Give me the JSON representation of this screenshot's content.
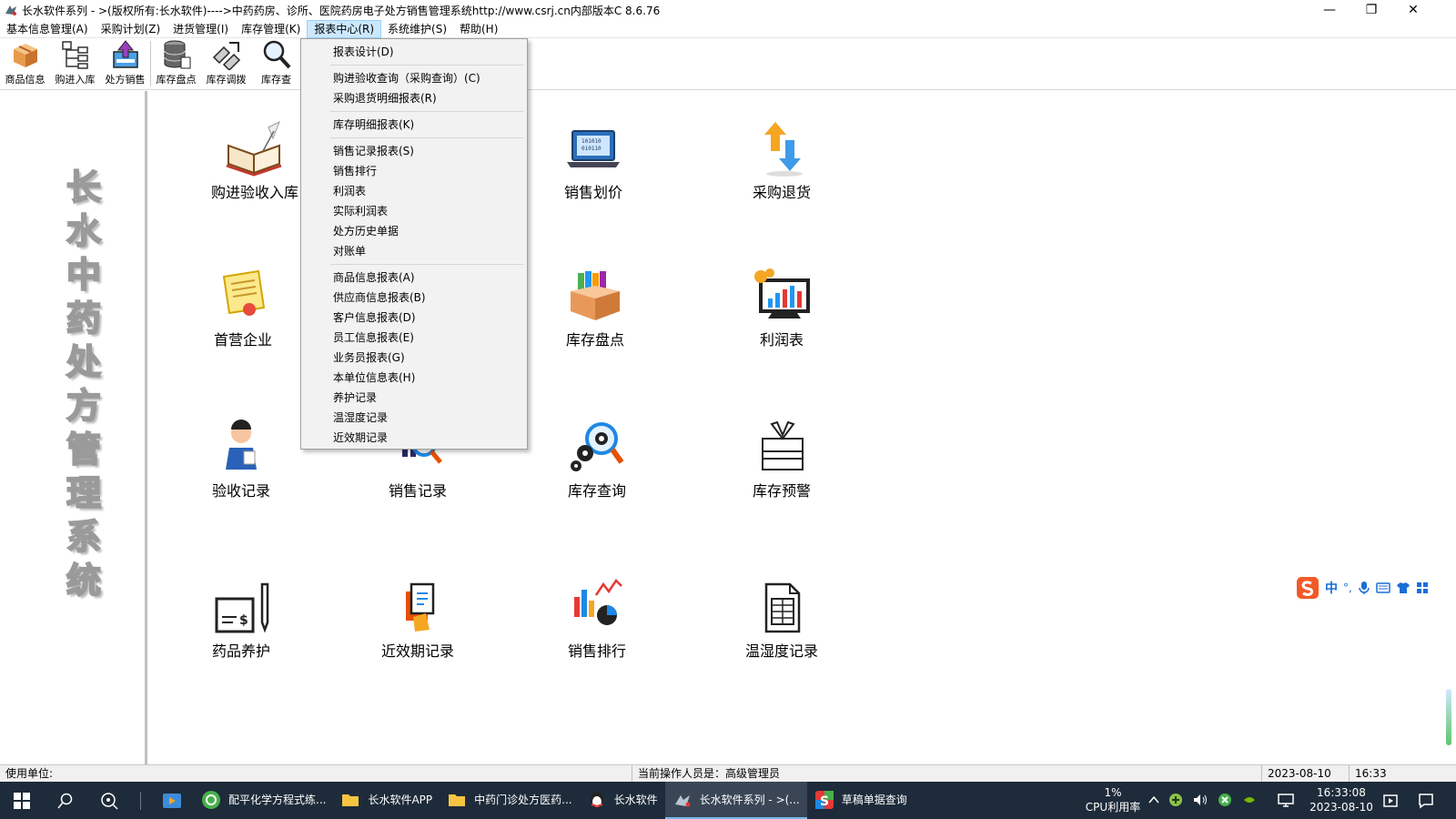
{
  "window": {
    "title": "长水软件系列 - >(版权所有:长水软件)---->中药药房、诊所、医院药房电子处方销售管理系统http://www.csrj.cn内部版本C 8.6.76",
    "buttons": {
      "minimize": "—",
      "restore": "❐",
      "close": "✕"
    }
  },
  "menubar": [
    "基本信息管理(A)",
    "采购计划(Z)",
    "进货管理(I)",
    "库存管理(K)",
    "报表中心(R)",
    "系统维护(S)",
    "帮助(H)"
  ],
  "toolbar": [
    {
      "label": "商品信息",
      "icon": "box-icon"
    },
    {
      "label": "购进入库",
      "icon": "tree-icon"
    },
    {
      "label": "处方销售",
      "icon": "upload-box-icon"
    },
    {
      "label": "库存盘点",
      "icon": "database-icon"
    },
    {
      "label": "库存调拨",
      "icon": "transfer-icon"
    },
    {
      "label": "库存查",
      "icon": "magnifier-icon"
    }
  ],
  "banner": {
    "chars": [
      "长",
      "水",
      "中",
      "药",
      "处",
      "方",
      "管",
      "理",
      "系",
      "统"
    ]
  },
  "dropdown": {
    "groups": [
      [
        "报表设计(D)"
      ],
      [
        "购进验收查询（采购查询）(C)",
        "采购退货明细报表(R)"
      ],
      [
        "库存明细报表(K)"
      ],
      [
        "销售记录报表(S)",
        "销售排行",
        "利润表",
        "实际利润表",
        "处方历史单据",
        "对账单"
      ],
      [
        "商品信息报表(A)",
        "供应商信息报表(B)",
        "客户信息报表(D)",
        "员工信息报表(E)",
        "业务员报表(G)",
        "本单位信息表(H)",
        "养护记录",
        "温湿度记录",
        "近效期记录"
      ]
    ]
  },
  "tiles": {
    "purchase_receive": "购进验收入库",
    "sales_pricing": "销售划价",
    "purchase_return": "采购退货",
    "first_supplier": "首营企业",
    "stock_check": "库存盘点",
    "profit_table": "利润表",
    "inspection_records": "验收记录",
    "sales_records": "销售记录",
    "stock_query": "库存查询",
    "stock_alert": "库存预警",
    "drug_maintenance": "药品养护",
    "near_expiry": "近效期记录",
    "sales_ranking": "销售排行",
    "humidity_records": "温湿度记录"
  },
  "statusbar": {
    "unit": "使用单位:",
    "operator": "当前操作人员是：高级管理员",
    "date": "2023-08-10",
    "time": "16:33"
  },
  "ime": {
    "mode": "中",
    "punct": "°,"
  },
  "taskbar": {
    "apps": [
      "配平化学方程式练...",
      "长水软件APP",
      "中药门诊处方医药...",
      "长水软件",
      "长水软件系列 - >(...",
      "草稿单据查询"
    ],
    "cpu_value": "1%",
    "cpu_label": "CPU利用率",
    "clock_time": "16:33:08",
    "clock_date": "2023-08-10"
  },
  "colors": {
    "menu_active_bg": "#cce8ff",
    "taskbar_bg": "#1e2b3a",
    "taskbar_active_bg": "#3a4656"
  }
}
